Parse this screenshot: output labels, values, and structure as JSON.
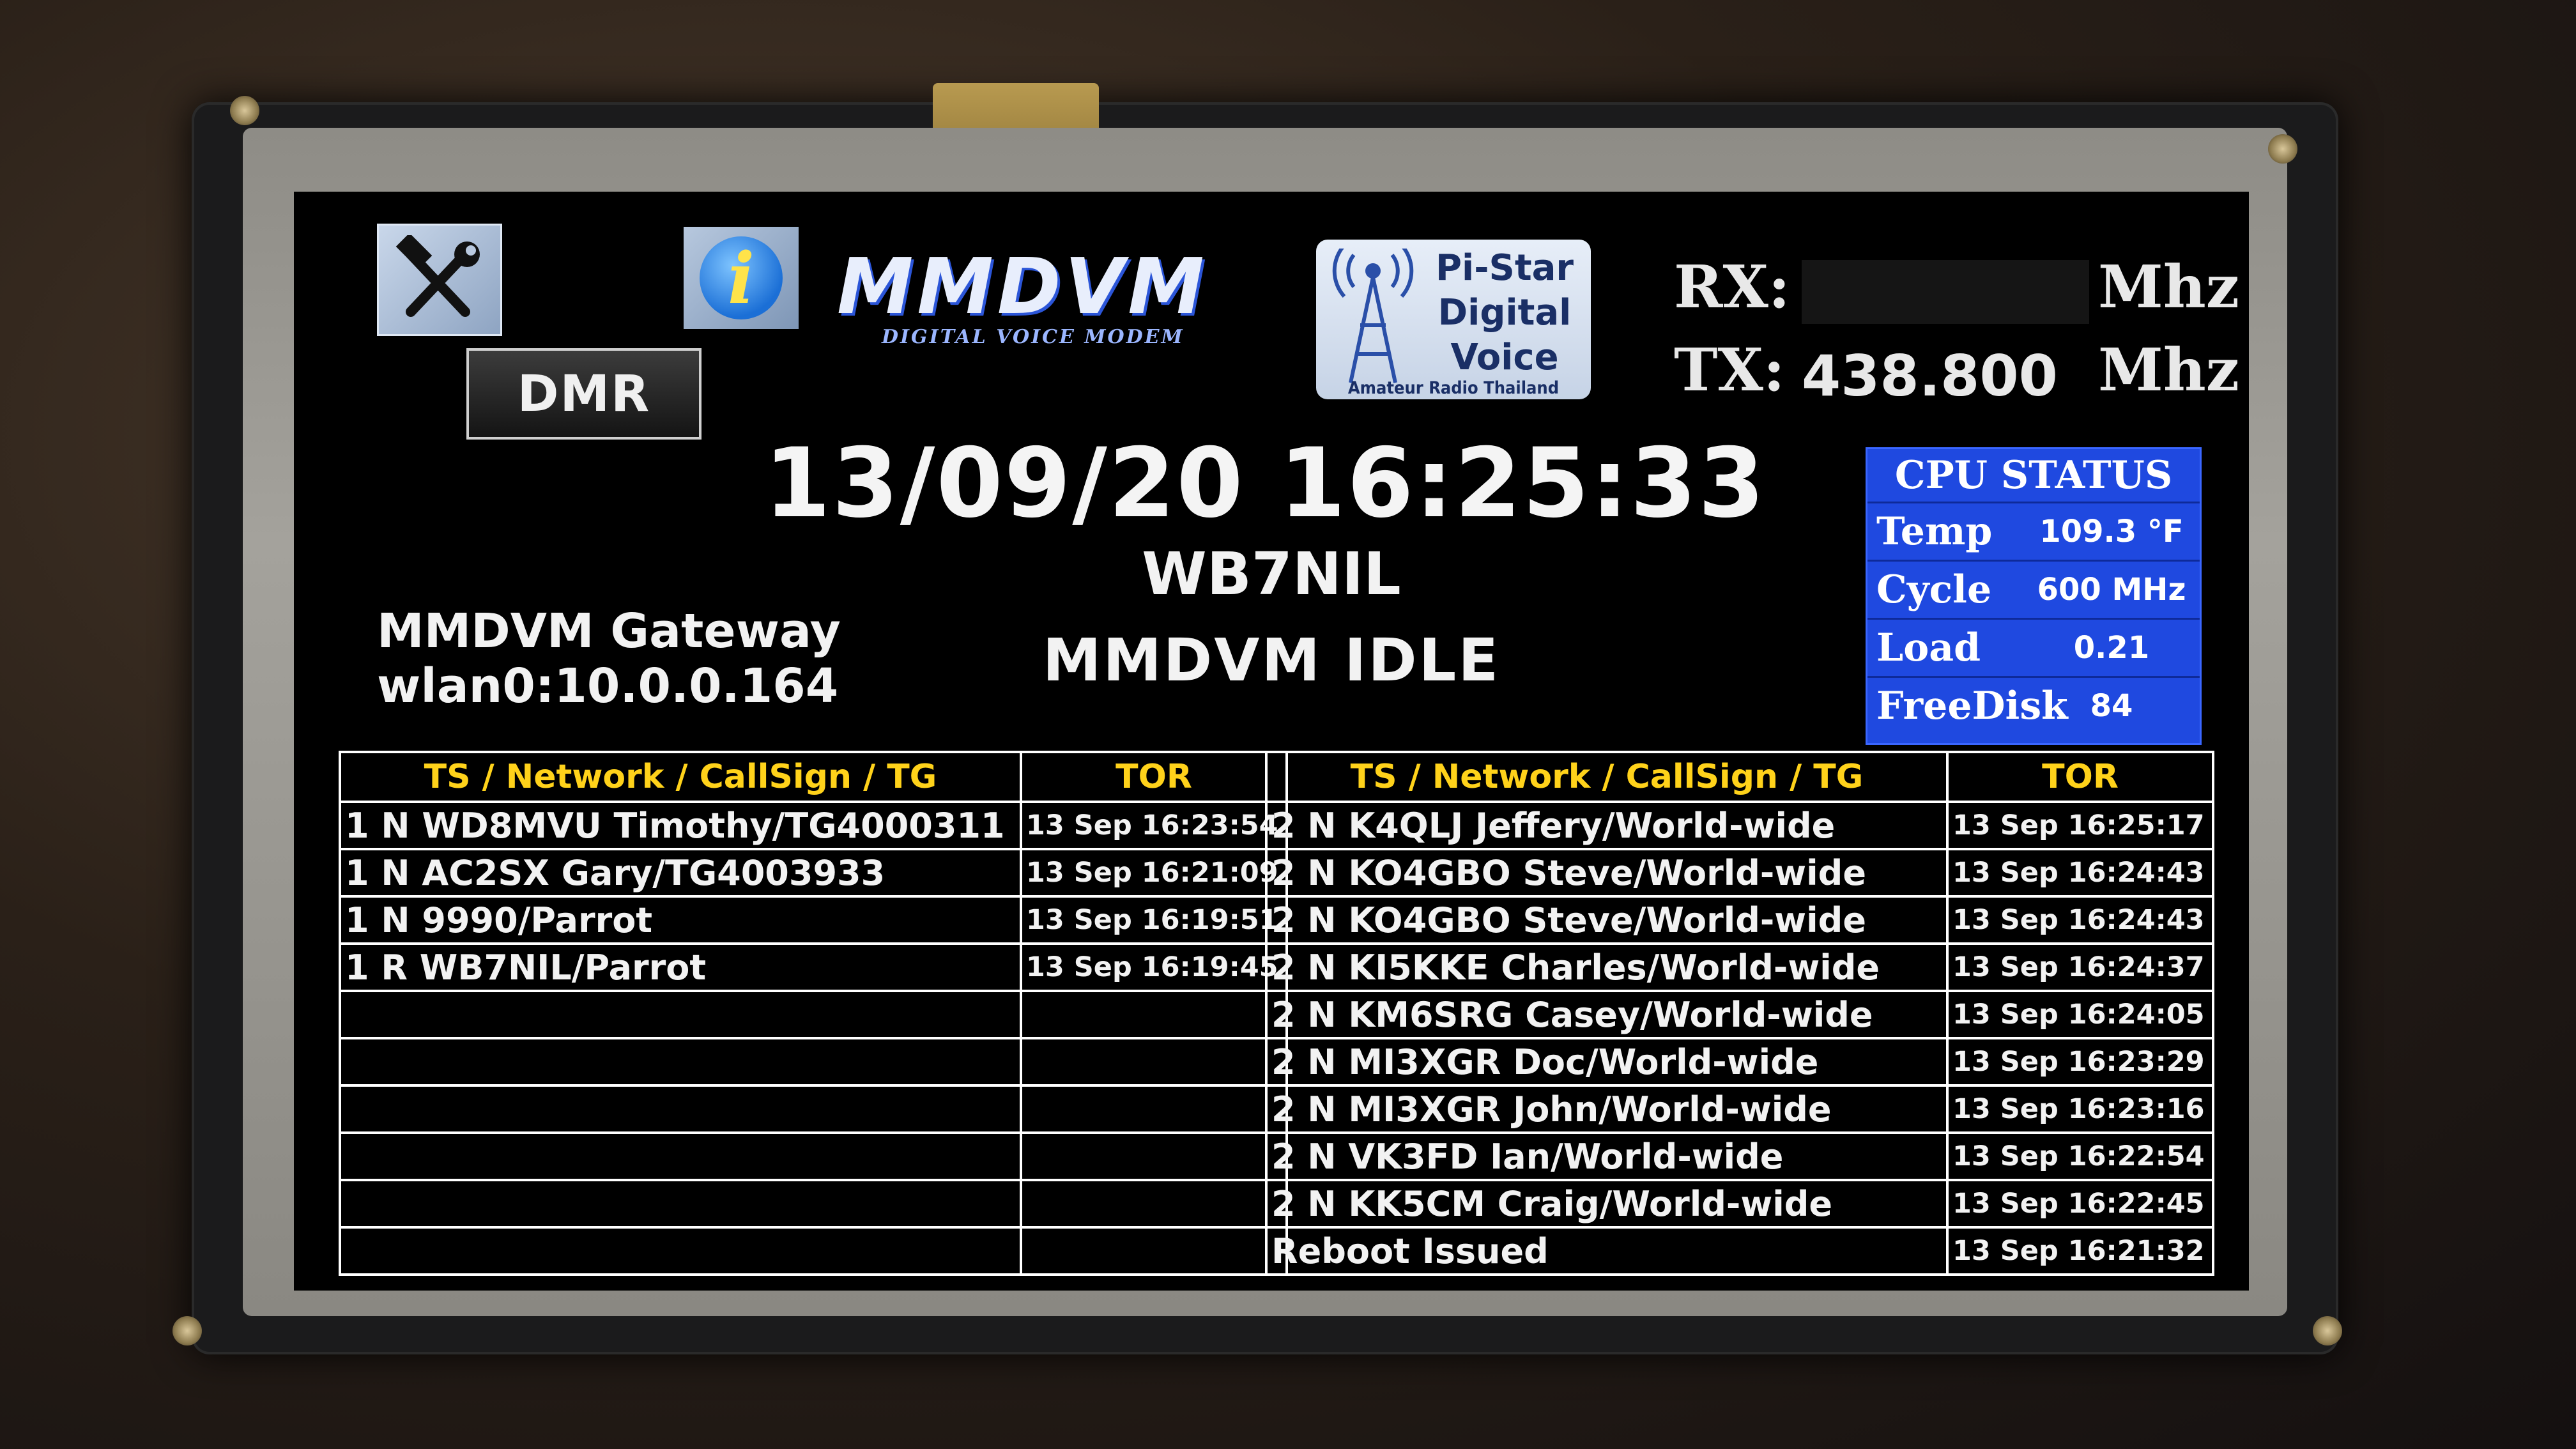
{
  "header": {
    "logo_mmdvm": "MMDVM",
    "logo_mmdvm_sub": "DIGITAL VOICE MODEM",
    "logo_dmr": "DMR",
    "pistar_lines": [
      "Pi-Star",
      "Digital",
      "Voice"
    ],
    "pistar_footer": "Amateur Radio Thailand"
  },
  "freq": {
    "rx_label": "RX:",
    "rx_value": "",
    "tx_label": "TX:",
    "tx_value": "438.800",
    "unit": "Mhz"
  },
  "status": {
    "datetime": "13/09/20 16:25:33",
    "callsign": "WB7NIL",
    "gateway_title": "MMDVM Gateway",
    "gateway_ip": "wlan0:10.0.0.164",
    "mode": "MMDVM IDLE"
  },
  "cpu": {
    "title": "CPU STATUS",
    "rows": [
      {
        "label": "Temp",
        "value": "109.3 °F"
      },
      {
        "label": "Cycle",
        "value": "600 MHz"
      },
      {
        "label": "Load",
        "value": "0.21"
      },
      {
        "label": "FreeDisk",
        "value": "84"
      }
    ]
  },
  "left_table": {
    "headers": [
      "TS / Network / CallSign / TG",
      "TOR"
    ],
    "rows": [
      [
        "1 N WD8MVU Timothy/TG4000311",
        "13 Sep 16:23:54"
      ],
      [
        "1 N AC2SX Gary/TG4003933",
        "13 Sep 16:21:09"
      ],
      [
        "1 N 9990/Parrot",
        "13 Sep 16:19:51"
      ],
      [
        "1 R WB7NIL/Parrot",
        "13 Sep 16:19:45"
      ],
      [
        "",
        ""
      ],
      [
        "",
        ""
      ],
      [
        "",
        ""
      ],
      [
        "",
        ""
      ],
      [
        "",
        ""
      ],
      [
        "",
        ""
      ]
    ]
  },
  "right_table": {
    "headers": [
      "TS / Network / CallSign / TG",
      "TOR"
    ],
    "rows": [
      [
        "2 N K4QLJ Jeffery/World-wide",
        "13 Sep 16:25:17"
      ],
      [
        "2 N KO4GBO Steve/World-wide",
        "13 Sep 16:24:43"
      ],
      [
        "2 N KO4GBO Steve/World-wide",
        "13 Sep 16:24:43"
      ],
      [
        "2 N KI5KKE Charles/World-wide",
        "13 Sep 16:24:37"
      ],
      [
        "2 N KM6SRG Casey/World-wide",
        "13 Sep 16:24:05"
      ],
      [
        "2 N MI3XGR Doc/World-wide",
        "13 Sep 16:23:29"
      ],
      [
        "2 N MI3XGR John/World-wide",
        "13 Sep 16:23:16"
      ],
      [
        "2 N VK3FD Ian/World-wide",
        "13 Sep 16:22:54"
      ],
      [
        "2 N KK5CM Craig/World-wide",
        "13 Sep 16:22:45"
      ],
      [
        "Reboot Issued",
        "13 Sep 16:21:32"
      ]
    ]
  }
}
